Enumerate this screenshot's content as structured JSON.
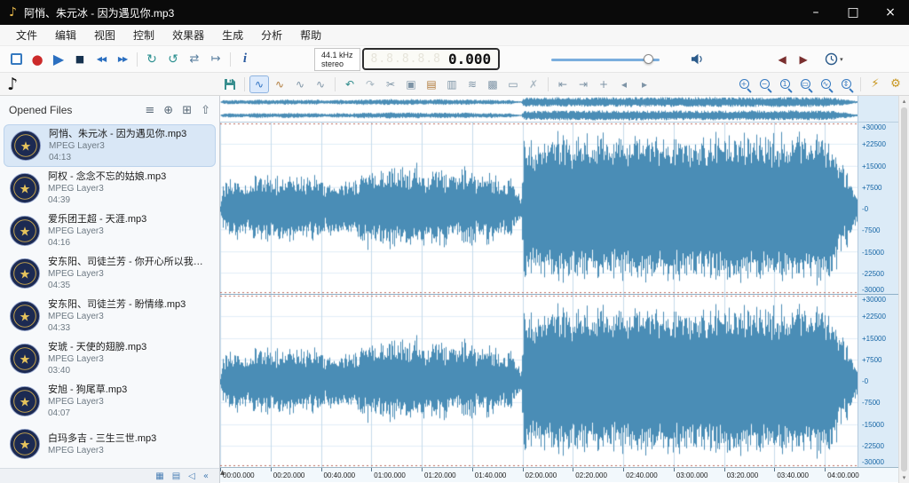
{
  "window": {
    "title": "阿悄、朱元冰 - 因为遇见你.mp3"
  },
  "menu": {
    "items": [
      "文件",
      "编辑",
      "视图",
      "控制",
      "效果器",
      "生成",
      "分析",
      "帮助"
    ]
  },
  "transport": {
    "sample_rate": "44.1 kHz",
    "channel_mode": "stereo",
    "lcd_segments": "8.8.8.8.8",
    "time_display": "0.000",
    "volume_percent": 85
  },
  "sidebar": {
    "title": "Opened Files",
    "files": [
      {
        "name": "阿悄、朱元冰 - 因为遇见你.mp3",
        "format": "MPEG Layer3",
        "duration": "04:13",
        "selected": true
      },
      {
        "name": "阿权 - 念念不忘的姑娘.mp3",
        "format": "MPEG Layer3",
        "duration": "04:39",
        "selected": false
      },
      {
        "name": "爱乐团王超 - 天涯.mp3",
        "format": "MPEG Layer3",
        "duration": "04:16",
        "selected": false
      },
      {
        "name": "安东阳、司徒兰芳 - 你开心所以我快...",
        "format": "MPEG Layer3",
        "duration": "04:35",
        "selected": false
      },
      {
        "name": "安东阳、司徒兰芳 - 盼情缘.mp3",
        "format": "MPEG Layer3",
        "duration": "04:33",
        "selected": false
      },
      {
        "name": "安琥 - 天使的翅膀.mp3",
        "format": "MPEG Layer3",
        "duration": "03:40",
        "selected": false
      },
      {
        "name": "安旭 - 狗尾草.mp3",
        "format": "MPEG Layer3",
        "duration": "04:07",
        "selected": false
      },
      {
        "name": "白玛多吉 - 三生三世.mp3",
        "format": "MPEG Layer3",
        "duration": "",
        "selected": false
      }
    ]
  },
  "waveform": {
    "color": "#4a8db6",
    "duration_seconds": 253,
    "amplitude_ticks": [
      "+30000",
      "+22500",
      "+15000",
      "+7500",
      "-0",
      "-7500",
      "-15000",
      "-22500",
      "-30000"
    ],
    "timeline_ticks": [
      "00:00.000",
      "00:20.000",
      "00:40.000",
      "01:00.000",
      "01:20.000",
      "01:40.000",
      "02:00.000",
      "02:20.000",
      "02:40.000",
      "03:00.000",
      "03:20.000",
      "03:40.000",
      "04:00.000"
    ],
    "envelope": [
      [
        0,
        0.05
      ],
      [
        0.004,
        0.35
      ],
      [
        0.02,
        0.42
      ],
      [
        0.04,
        0.34
      ],
      [
        0.06,
        0.48
      ],
      [
        0.085,
        0.38
      ],
      [
        0.105,
        0.52
      ],
      [
        0.13,
        0.4
      ],
      [
        0.15,
        0.5
      ],
      [
        0.165,
        0.28
      ],
      [
        0.185,
        0.44
      ],
      [
        0.205,
        0.36
      ],
      [
        0.225,
        0.56
      ],
      [
        0.245,
        0.46
      ],
      [
        0.265,
        0.6
      ],
      [
        0.285,
        0.5
      ],
      [
        0.305,
        0.58
      ],
      [
        0.325,
        0.44
      ],
      [
        0.345,
        0.56
      ],
      [
        0.365,
        0.44
      ],
      [
        0.385,
        0.54
      ],
      [
        0.405,
        0.4
      ],
      [
        0.425,
        0.5
      ],
      [
        0.44,
        0.34
      ],
      [
        0.455,
        0.42
      ],
      [
        0.465,
        0.22
      ],
      [
        0.472,
        0.14
      ],
      [
        0.476,
        0.9
      ],
      [
        0.5,
        0.86
      ],
      [
        0.53,
        0.95
      ],
      [
        0.56,
        0.88
      ],
      [
        0.59,
        0.96
      ],
      [
        0.62,
        0.9
      ],
      [
        0.65,
        0.96
      ],
      [
        0.68,
        0.89
      ],
      [
        0.71,
        0.95
      ],
      [
        0.74,
        0.9
      ],
      [
        0.77,
        0.96
      ],
      [
        0.8,
        0.91
      ],
      [
        0.83,
        0.96
      ],
      [
        0.86,
        0.9
      ],
      [
        0.89,
        0.96
      ],
      [
        0.92,
        0.92
      ],
      [
        0.945,
        0.96
      ],
      [
        0.962,
        0.85
      ],
      [
        0.975,
        0.65
      ],
      [
        0.988,
        0.4
      ],
      [
        1,
        0.15
      ]
    ]
  },
  "icons": {
    "app_note": "♪",
    "minimize": "–",
    "maximize": "□",
    "close": "×",
    "record": "●",
    "play": "▶",
    "stop": "■",
    "rewind": "◀◀",
    "fast_forward": "▶▶",
    "loop_play": "↻",
    "loop_selection": "↺",
    "shuttle": "⇄",
    "play_to_end": "↦",
    "info": "i",
    "seek_back": "◀",
    "seek_forward": "▶",
    "caret_down": "▾",
    "filter": "≡",
    "add": "⊕",
    "duplicate": "⊞",
    "export": "⇧",
    "note": "♪",
    "view_all": "∿",
    "view_selection": "∿",
    "view_previous": "∿",
    "view_cue": "∿",
    "undo": "↶",
    "redo": "↷",
    "cut": "✂",
    "copy": "▣",
    "paste": "▤",
    "paste_new": "▥",
    "mix": "≋",
    "replace": "▩",
    "trim": "▭",
    "delete": "✗",
    "select_start": "⇤",
    "select_end": "⇥",
    "add_marker": "+",
    "cue_previous": "◂",
    "cue_next": "▸",
    "zoom_in": "+",
    "zoom_out": "−",
    "zoom_100": "1",
    "zoom_selection": "▭",
    "zoom_all": "∿",
    "zoom_vertical": "⇕",
    "device_properties": "⚡",
    "settings": "⚙",
    "grid_view": "▦",
    "list_view": "▤",
    "mute": "◁",
    "collapse": "«",
    "scroll_up": "▴",
    "scroll_down": "▾",
    "playhead_marker": "▲"
  }
}
